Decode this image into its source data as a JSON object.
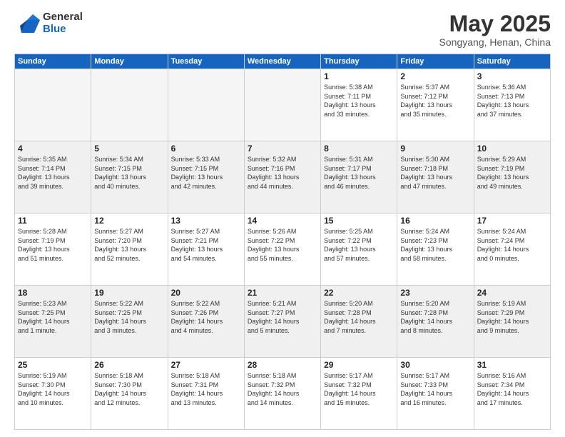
{
  "logo": {
    "general": "General",
    "blue": "Blue"
  },
  "title": "May 2025",
  "location": "Songyang, Henan, China",
  "days_header": [
    "Sunday",
    "Monday",
    "Tuesday",
    "Wednesday",
    "Thursday",
    "Friday",
    "Saturday"
  ],
  "weeks": [
    [
      {
        "num": "",
        "info": ""
      },
      {
        "num": "",
        "info": ""
      },
      {
        "num": "",
        "info": ""
      },
      {
        "num": "",
        "info": ""
      },
      {
        "num": "1",
        "info": "Sunrise: 5:38 AM\nSunset: 7:11 PM\nDaylight: 13 hours\nand 33 minutes."
      },
      {
        "num": "2",
        "info": "Sunrise: 5:37 AM\nSunset: 7:12 PM\nDaylight: 13 hours\nand 35 minutes."
      },
      {
        "num": "3",
        "info": "Sunrise: 5:36 AM\nSunset: 7:13 PM\nDaylight: 13 hours\nand 37 minutes."
      }
    ],
    [
      {
        "num": "4",
        "info": "Sunrise: 5:35 AM\nSunset: 7:14 PM\nDaylight: 13 hours\nand 39 minutes."
      },
      {
        "num": "5",
        "info": "Sunrise: 5:34 AM\nSunset: 7:15 PM\nDaylight: 13 hours\nand 40 minutes."
      },
      {
        "num": "6",
        "info": "Sunrise: 5:33 AM\nSunset: 7:15 PM\nDaylight: 13 hours\nand 42 minutes."
      },
      {
        "num": "7",
        "info": "Sunrise: 5:32 AM\nSunset: 7:16 PM\nDaylight: 13 hours\nand 44 minutes."
      },
      {
        "num": "8",
        "info": "Sunrise: 5:31 AM\nSunset: 7:17 PM\nDaylight: 13 hours\nand 46 minutes."
      },
      {
        "num": "9",
        "info": "Sunrise: 5:30 AM\nSunset: 7:18 PM\nDaylight: 13 hours\nand 47 minutes."
      },
      {
        "num": "10",
        "info": "Sunrise: 5:29 AM\nSunset: 7:19 PM\nDaylight: 13 hours\nand 49 minutes."
      }
    ],
    [
      {
        "num": "11",
        "info": "Sunrise: 5:28 AM\nSunset: 7:19 PM\nDaylight: 13 hours\nand 51 minutes."
      },
      {
        "num": "12",
        "info": "Sunrise: 5:27 AM\nSunset: 7:20 PM\nDaylight: 13 hours\nand 52 minutes."
      },
      {
        "num": "13",
        "info": "Sunrise: 5:27 AM\nSunset: 7:21 PM\nDaylight: 13 hours\nand 54 minutes."
      },
      {
        "num": "14",
        "info": "Sunrise: 5:26 AM\nSunset: 7:22 PM\nDaylight: 13 hours\nand 55 minutes."
      },
      {
        "num": "15",
        "info": "Sunrise: 5:25 AM\nSunset: 7:22 PM\nDaylight: 13 hours\nand 57 minutes."
      },
      {
        "num": "16",
        "info": "Sunrise: 5:24 AM\nSunset: 7:23 PM\nDaylight: 13 hours\nand 58 minutes."
      },
      {
        "num": "17",
        "info": "Sunrise: 5:24 AM\nSunset: 7:24 PM\nDaylight: 14 hours\nand 0 minutes."
      }
    ],
    [
      {
        "num": "18",
        "info": "Sunrise: 5:23 AM\nSunset: 7:25 PM\nDaylight: 14 hours\nand 1 minute."
      },
      {
        "num": "19",
        "info": "Sunrise: 5:22 AM\nSunset: 7:25 PM\nDaylight: 14 hours\nand 3 minutes."
      },
      {
        "num": "20",
        "info": "Sunrise: 5:22 AM\nSunset: 7:26 PM\nDaylight: 14 hours\nand 4 minutes."
      },
      {
        "num": "21",
        "info": "Sunrise: 5:21 AM\nSunset: 7:27 PM\nDaylight: 14 hours\nand 5 minutes."
      },
      {
        "num": "22",
        "info": "Sunrise: 5:20 AM\nSunset: 7:28 PM\nDaylight: 14 hours\nand 7 minutes."
      },
      {
        "num": "23",
        "info": "Sunrise: 5:20 AM\nSunset: 7:28 PM\nDaylight: 14 hours\nand 8 minutes."
      },
      {
        "num": "24",
        "info": "Sunrise: 5:19 AM\nSunset: 7:29 PM\nDaylight: 14 hours\nand 9 minutes."
      }
    ],
    [
      {
        "num": "25",
        "info": "Sunrise: 5:19 AM\nSunset: 7:30 PM\nDaylight: 14 hours\nand 10 minutes."
      },
      {
        "num": "26",
        "info": "Sunrise: 5:18 AM\nSunset: 7:30 PM\nDaylight: 14 hours\nand 12 minutes."
      },
      {
        "num": "27",
        "info": "Sunrise: 5:18 AM\nSunset: 7:31 PM\nDaylight: 14 hours\nand 13 minutes."
      },
      {
        "num": "28",
        "info": "Sunrise: 5:18 AM\nSunset: 7:32 PM\nDaylight: 14 hours\nand 14 minutes."
      },
      {
        "num": "29",
        "info": "Sunrise: 5:17 AM\nSunset: 7:32 PM\nDaylight: 14 hours\nand 15 minutes."
      },
      {
        "num": "30",
        "info": "Sunrise: 5:17 AM\nSunset: 7:33 PM\nDaylight: 14 hours\nand 16 minutes."
      },
      {
        "num": "31",
        "info": "Sunrise: 5:16 AM\nSunset: 7:34 PM\nDaylight: 14 hours\nand 17 minutes."
      }
    ]
  ]
}
